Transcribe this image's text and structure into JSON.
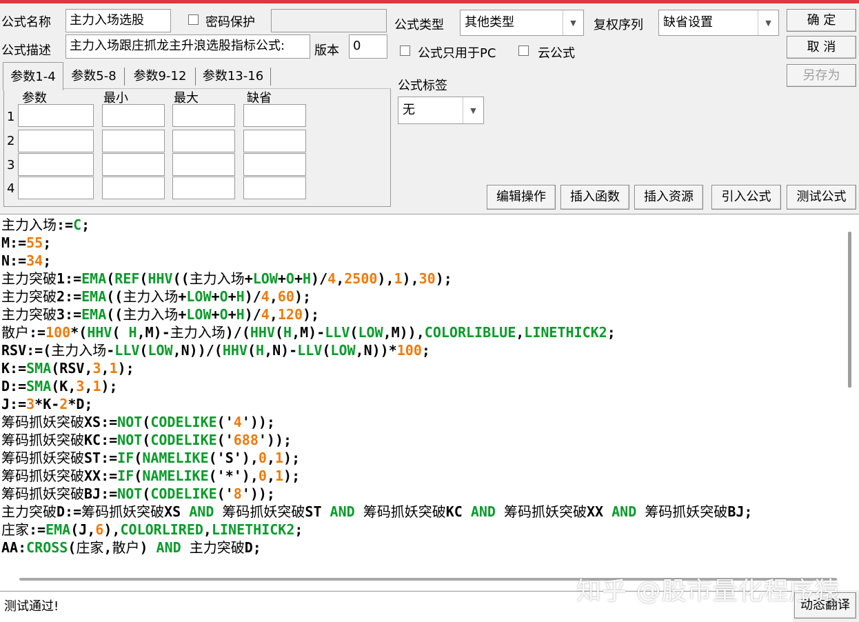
{
  "colors": {
    "accent_bar": "#e0363f",
    "function": "#0a9b2a",
    "number": "#f07a0a",
    "text": "#000000"
  },
  "header": {
    "formula_name_label": "公式名称",
    "formula_name_value": "主力入场选股",
    "password_label": "密码保护",
    "formula_desc_label": "公式描述",
    "formula_desc_value": "主力入场跟庄抓龙主升浪选股指标公式:",
    "version_label": "版本",
    "version_value": "0",
    "type_label": "公式类型",
    "type_value": "其他类型",
    "restore_label": "复权序列",
    "restore_value": "缺省设置",
    "pc_only_label": "公式只用于PC",
    "cloud_label": "云公式",
    "tag_label": "公式标签",
    "tag_value": "无"
  },
  "buttons": {
    "ok": "确  定",
    "cancel": "取  消",
    "save_as": "另存为",
    "edit_ops": "编辑操作",
    "insert_func": "插入函数",
    "insert_res": "插入资源",
    "import_formula": "引入公式",
    "test_formula": "测试公式",
    "dynamic_translate": "动态翻译"
  },
  "tabs": [
    "参数1-4",
    "参数5-8",
    "参数9-12",
    "参数13-16"
  ],
  "param_headers": [
    "参数",
    "最小",
    "最大",
    "缺省"
  ],
  "param_rows": [
    "1",
    "2",
    "3",
    "4"
  ],
  "code_lines": [
    [
      [
        "主力入场",
        "c"
      ],
      [
        ":=",
        "n"
      ],
      [
        "C",
        "f"
      ],
      [
        ";",
        "n"
      ]
    ],
    [
      [
        "M:=",
        "n"
      ],
      [
        "55",
        "x"
      ],
      [
        ";",
        "n"
      ]
    ],
    [
      [
        "N:=",
        "n"
      ],
      [
        "34",
        "x"
      ],
      [
        ";",
        "n"
      ]
    ],
    [
      [
        "主力突破",
        "c"
      ],
      [
        "1:=",
        "n"
      ],
      [
        "EMA",
        "f"
      ],
      [
        "(",
        "n"
      ],
      [
        "REF",
        "f"
      ],
      [
        "(",
        "n"
      ],
      [
        "HHV",
        "f"
      ],
      [
        "((",
        "n"
      ],
      [
        "主力入场",
        "c"
      ],
      [
        "+",
        "n"
      ],
      [
        "LOW",
        "f"
      ],
      [
        "+",
        "n"
      ],
      [
        "O",
        "f"
      ],
      [
        "+",
        "n"
      ],
      [
        "H",
        "f"
      ],
      [
        ")/",
        "n"
      ],
      [
        "4",
        "x"
      ],
      [
        ",",
        "n"
      ],
      [
        "2500",
        "x"
      ],
      [
        "),",
        "n"
      ],
      [
        "1",
        "x"
      ],
      [
        "),",
        "n"
      ],
      [
        "30",
        "x"
      ],
      [
        ");",
        "n"
      ]
    ],
    [
      [
        "主力突破",
        "c"
      ],
      [
        "2:=",
        "n"
      ],
      [
        "EMA",
        "f"
      ],
      [
        "((",
        "n"
      ],
      [
        "主力入场",
        "c"
      ],
      [
        "+",
        "n"
      ],
      [
        "LOW",
        "f"
      ],
      [
        "+",
        "n"
      ],
      [
        "O",
        "f"
      ],
      [
        "+",
        "n"
      ],
      [
        "H",
        "f"
      ],
      [
        ")/",
        "n"
      ],
      [
        "4",
        "x"
      ],
      [
        ",",
        "n"
      ],
      [
        "60",
        "x"
      ],
      [
        ");",
        "n"
      ]
    ],
    [
      [
        "主力突破",
        "c"
      ],
      [
        "3:=",
        "n"
      ],
      [
        "EMA",
        "f"
      ],
      [
        "((",
        "n"
      ],
      [
        "主力入场",
        "c"
      ],
      [
        "+",
        "n"
      ],
      [
        "LOW",
        "f"
      ],
      [
        "+",
        "n"
      ],
      [
        "O",
        "f"
      ],
      [
        "+",
        "n"
      ],
      [
        "H",
        "f"
      ],
      [
        ")/",
        "n"
      ],
      [
        "4",
        "x"
      ],
      [
        ",",
        "n"
      ],
      [
        "120",
        "x"
      ],
      [
        ");",
        "n"
      ]
    ],
    [
      [
        "散户",
        "c"
      ],
      [
        ":=",
        "n"
      ],
      [
        "100",
        "x"
      ],
      [
        "*(",
        "n"
      ],
      [
        "HHV",
        "f"
      ],
      [
        "( ",
        "n"
      ],
      [
        "H",
        "f"
      ],
      [
        ",M)-",
        "n"
      ],
      [
        "主力入场",
        "c"
      ],
      [
        ")/(",
        "n"
      ],
      [
        "HHV",
        "f"
      ],
      [
        "(",
        "n"
      ],
      [
        "H",
        "f"
      ],
      [
        ",M)-",
        "n"
      ],
      [
        "LLV",
        "f"
      ],
      [
        "(",
        "n"
      ],
      [
        "LOW",
        "f"
      ],
      [
        ",M)),",
        "n"
      ],
      [
        "COLORLIBLUE",
        "f"
      ],
      [
        ",",
        "n"
      ],
      [
        "LINETHICK2",
        "f"
      ],
      [
        ";",
        "n"
      ]
    ],
    [
      [
        "RSV:=(",
        "n"
      ],
      [
        "主力入场",
        "c"
      ],
      [
        "-",
        "n"
      ],
      [
        "LLV",
        "f"
      ],
      [
        "(",
        "n"
      ],
      [
        "LOW",
        "f"
      ],
      [
        ",N))/(",
        "n"
      ],
      [
        "HHV",
        "f"
      ],
      [
        "(",
        "n"
      ],
      [
        "H",
        "f"
      ],
      [
        ",N)-",
        "n"
      ],
      [
        "LLV",
        "f"
      ],
      [
        "(",
        "n"
      ],
      [
        "LOW",
        "f"
      ],
      [
        ",N))*",
        "n"
      ],
      [
        "100",
        "x"
      ],
      [
        ";",
        "n"
      ]
    ],
    [
      [
        "K:=",
        "n"
      ],
      [
        "SMA",
        "f"
      ],
      [
        "(RSV,",
        "n"
      ],
      [
        "3",
        "x"
      ],
      [
        ",",
        "n"
      ],
      [
        "1",
        "x"
      ],
      [
        ");",
        "n"
      ]
    ],
    [
      [
        "D:=",
        "n"
      ],
      [
        "SMA",
        "f"
      ],
      [
        "(K,",
        "n"
      ],
      [
        "3",
        "x"
      ],
      [
        ",",
        "n"
      ],
      [
        "1",
        "x"
      ],
      [
        ");",
        "n"
      ]
    ],
    [
      [
        "J:=",
        "n"
      ],
      [
        "3",
        "x"
      ],
      [
        "*K-",
        "n"
      ],
      [
        "2",
        "x"
      ],
      [
        "*D;",
        "n"
      ]
    ],
    [
      [
        "筹码抓妖突破",
        "c"
      ],
      [
        "XS:=",
        "n"
      ],
      [
        "NOT",
        "f"
      ],
      [
        "(",
        "n"
      ],
      [
        "CODELIKE",
        "f"
      ],
      [
        "('",
        "n"
      ],
      [
        "4",
        "x"
      ],
      [
        "'));",
        "n"
      ]
    ],
    [
      [
        "筹码抓妖突破",
        "c"
      ],
      [
        "KC:=",
        "n"
      ],
      [
        "NOT",
        "f"
      ],
      [
        "(",
        "n"
      ],
      [
        "CODELIKE",
        "f"
      ],
      [
        "('",
        "n"
      ],
      [
        "688",
        "x"
      ],
      [
        "'));",
        "n"
      ]
    ],
    [
      [
        "筹码抓妖突破",
        "c"
      ],
      [
        "ST:=",
        "n"
      ],
      [
        "IF",
        "f"
      ],
      [
        "(",
        "n"
      ],
      [
        "NAMELIKE",
        "f"
      ],
      [
        "('S'),",
        "n"
      ],
      [
        "0",
        "x"
      ],
      [
        ",",
        "n"
      ],
      [
        "1",
        "x"
      ],
      [
        ");",
        "n"
      ]
    ],
    [
      [
        "筹码抓妖突破",
        "c"
      ],
      [
        "XX:=",
        "n"
      ],
      [
        "IF",
        "f"
      ],
      [
        "(",
        "n"
      ],
      [
        "NAMELIKE",
        "f"
      ],
      [
        "('*'),",
        "n"
      ],
      [
        "0",
        "x"
      ],
      [
        ",",
        "n"
      ],
      [
        "1",
        "x"
      ],
      [
        ");",
        "n"
      ]
    ],
    [
      [
        "筹码抓妖突破",
        "c"
      ],
      [
        "BJ:=",
        "n"
      ],
      [
        "NOT",
        "f"
      ],
      [
        "(",
        "n"
      ],
      [
        "CODELIKE",
        "f"
      ],
      [
        "('",
        "n"
      ],
      [
        "8",
        "x"
      ],
      [
        "'));",
        "n"
      ]
    ],
    [
      [
        "主力突破",
        "c"
      ],
      [
        "D:=",
        "n"
      ],
      [
        "筹码抓妖突破",
        "c"
      ],
      [
        "XS ",
        "n"
      ],
      [
        "AND",
        "f"
      ],
      [
        " ",
        "n"
      ],
      [
        "筹码抓妖突破",
        "c"
      ],
      [
        "ST ",
        "n"
      ],
      [
        "AND",
        "f"
      ],
      [
        " ",
        "n"
      ],
      [
        "筹码抓妖突破",
        "c"
      ],
      [
        "KC ",
        "n"
      ],
      [
        "AND",
        "f"
      ],
      [
        " ",
        "n"
      ],
      [
        "筹码抓妖突破",
        "c"
      ],
      [
        "XX ",
        "n"
      ],
      [
        "AND",
        "f"
      ],
      [
        " ",
        "n"
      ],
      [
        "筹码抓妖突破",
        "c"
      ],
      [
        "BJ;",
        "n"
      ]
    ],
    [
      [
        "庄家",
        "c"
      ],
      [
        ":=",
        "n"
      ],
      [
        "EMA",
        "f"
      ],
      [
        "(J,",
        "n"
      ],
      [
        "6",
        "x"
      ],
      [
        "),",
        "n"
      ],
      [
        "COLORLIRED",
        "f"
      ],
      [
        ",",
        "n"
      ],
      [
        "LINETHICK2",
        "f"
      ],
      [
        ";",
        "n"
      ]
    ],
    [
      [
        "AA:",
        "n"
      ],
      [
        "CROSS",
        "f"
      ],
      [
        "(",
        "n"
      ],
      [
        "庄家",
        "c"
      ],
      [
        ",",
        "n"
      ],
      [
        "散户",
        "c"
      ],
      [
        ") ",
        "n"
      ],
      [
        "AND",
        "f"
      ],
      [
        " ",
        "n"
      ],
      [
        "主力突破",
        "c"
      ],
      [
        "D;",
        "n"
      ]
    ]
  ],
  "status": {
    "message": "测试通过!"
  },
  "watermark": "知乎 @股市量化程序猿"
}
